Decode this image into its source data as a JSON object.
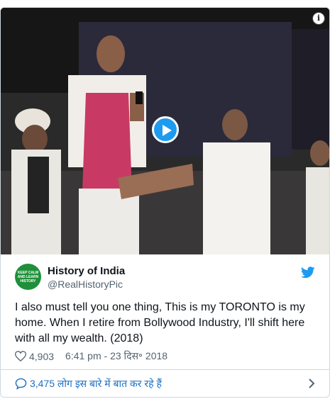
{
  "video": {
    "info_icon": "info-icon",
    "play_icon": "play-icon"
  },
  "tweet": {
    "author_name": "History of India",
    "author_handle": "@RealHistoryPic",
    "avatar_text": "KEEP CALM AND LEARN HISTORY",
    "text": "I also must tell you one thing, This is my TORONTO is my home. When I retire from Bollywood Industry, I'll shift here with all my wealth. (2018)",
    "likes": "4,903",
    "timestamp": "6:41 pm - 23 दिस॰ 2018",
    "reply_text": "3,475 लोग इस बारे में बात कर रहे हैं"
  },
  "colors": {
    "accent": "#1d9bf0",
    "link": "#1b6fc2",
    "muted": "#536471"
  }
}
